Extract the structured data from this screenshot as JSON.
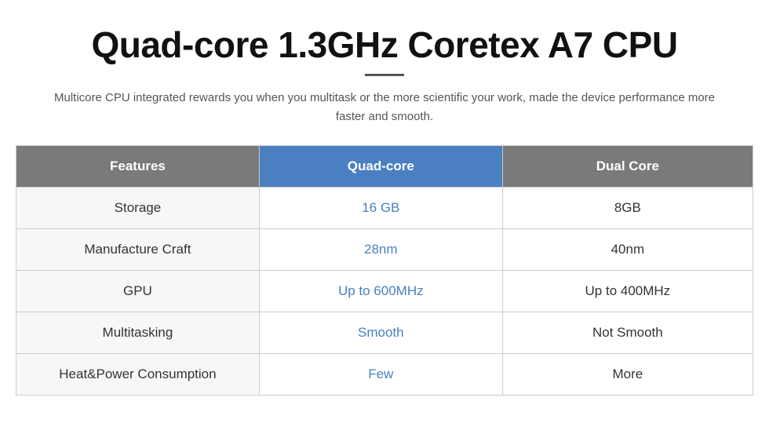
{
  "title": "Quad-core 1.3GHz Coretex A7 CPU",
  "subtitle": "Multicore CPU integrated rewards you when you multitask or the more scientific your work, made the device performance more faster and smooth.",
  "table": {
    "headers": {
      "features": "Features",
      "quadcore": "Quad-core",
      "dualcore": "Dual Core"
    },
    "rows": [
      {
        "feature": "Storage",
        "quadcore": "16 GB",
        "dualcore": "8GB"
      },
      {
        "feature": "Manufacture Craft",
        "quadcore": "28nm",
        "dualcore": "40nm"
      },
      {
        "feature": "GPU",
        "quadcore": "Up to 600MHz",
        "dualcore": "Up to 400MHz"
      },
      {
        "feature": "Multitasking",
        "quadcore": "Smooth",
        "dualcore": "Not Smooth"
      },
      {
        "feature": "Heat&Power Consumption",
        "quadcore": "Few",
        "dualcore": "More"
      }
    ]
  }
}
